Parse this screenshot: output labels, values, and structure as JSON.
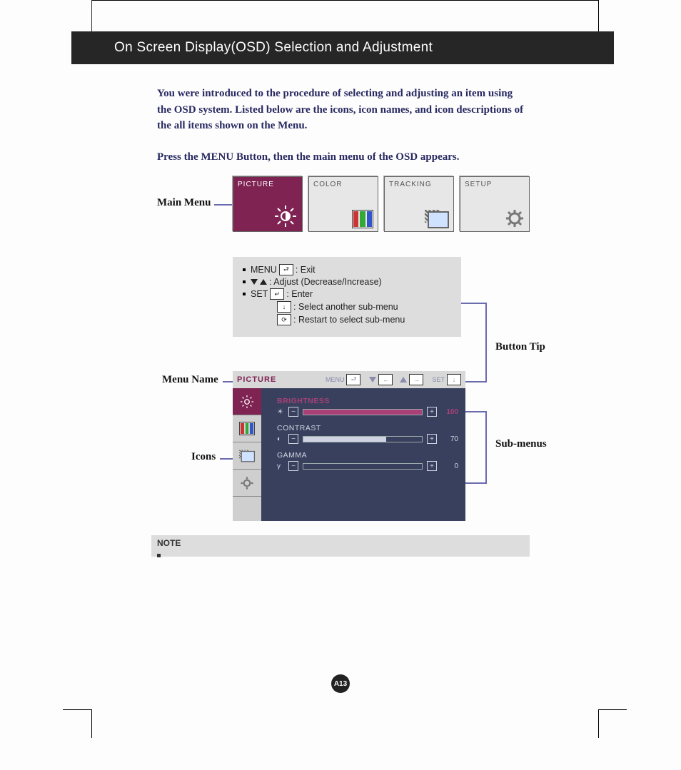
{
  "header": {
    "title": "On Screen Display(OSD) Selection and Adjustment"
  },
  "intro": "You were introduced to the procedure of selecting and adjusting an item using the OSD system.  Listed below are the icons, icon names, and icon descriptions of the all items shown on the Menu.",
  "press": "Press the MENU Button, then the main menu of the OSD appears.",
  "main_menu": {
    "label": "Main Menu",
    "tiles": [
      {
        "name": "PICTURE",
        "active": true
      },
      {
        "name": "COLOR",
        "active": false
      },
      {
        "name": "TRACKING",
        "active": false
      },
      {
        "name": "SETUP",
        "active": false
      }
    ]
  },
  "button_tip": {
    "label": "Button Tip",
    "rows": {
      "menu": "MENU",
      "menu_desc": ": Exit",
      "adjust_desc": ": Adjust (Decrease/Increase)",
      "set": "SET",
      "set_desc": ": Enter",
      "down_desc": ": Select another sub-menu",
      "cycle_desc": ": Restart to select sub-menu"
    }
  },
  "labels": {
    "menu_name": "Menu Name",
    "icons": "Icons",
    "sub_menus": "Sub-menus"
  },
  "osd": {
    "title": "PICTURE",
    "toolbar": {
      "menu": "MENU",
      "set": "SET"
    },
    "subs": [
      {
        "name": "BRIGHTNESS",
        "value": 100,
        "selected": true
      },
      {
        "name": "CONTRAST",
        "value": 70,
        "selected": false
      },
      {
        "name": "GAMMA",
        "value": 0,
        "selected": false
      }
    ]
  },
  "note": {
    "label": "NOTE"
  },
  "page_number": "A13"
}
